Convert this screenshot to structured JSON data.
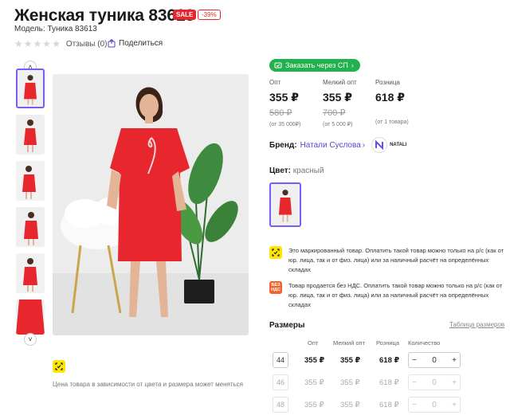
{
  "product": {
    "title": "Женская туника 83613",
    "sale_badge": "SALE",
    "discount_badge": "-39%",
    "model": "Модель: Туника 83613",
    "reviews": "Отзывы (0)",
    "share": "Поделиться",
    "rating_stars": 0
  },
  "gallery": {
    "price_note": "Цена товара в зависимости от цвета и размера может меняться"
  },
  "order_sp_button": "Заказать через СП",
  "prices": [
    {
      "head": "Опт",
      "price": "355 ₽",
      "old": "580 ₽",
      "note": "(от 35 000₽)"
    },
    {
      "head": "Мелкий опт",
      "price": "355 ₽",
      "old": "700 ₽",
      "note": "(от 5 000 ₽)"
    },
    {
      "head": "Розница",
      "price": "618 ₽",
      "old": "",
      "note": "(от 1 товара)"
    }
  ],
  "brand": {
    "label": "Бренд:",
    "name": "Натали Суслова",
    "arrow": "›",
    "logo_text": "NATALI"
  },
  "color": {
    "label": "Цвет:",
    "value": "красный"
  },
  "info": [
    {
      "text": "Это маркированный товар. Оплатить такой товар можно только на р/с (как от юр. лица, так и от физ. лица) или за наличный расчёт на определённых складах"
    },
    {
      "icon_text": "БЕЗ НДС",
      "text": "Товар продается без НДС. Оплатить такой товар можно только на р/с (как от юр. лица, так и от физ. лица) или за наличный расчёт на определённых складах"
    }
  ],
  "sizes": {
    "label": "Размеры",
    "table_link": "Таблица размеров",
    "headers": {
      "opt": "Опт",
      "small_opt": "Мелкий опт",
      "retail": "Розница",
      "qty": "Количество"
    },
    "rows": [
      {
        "size": "44",
        "opt": "355 ₽",
        "small_opt": "355 ₽",
        "retail": "618 ₽",
        "qty": "0"
      },
      {
        "size": "46",
        "opt": "355 ₽",
        "small_opt": "355 ₽",
        "retail": "618 ₽",
        "qty": "0"
      },
      {
        "size": "48",
        "opt": "355 ₽",
        "small_opt": "355 ₽",
        "retail": "618 ₽",
        "qty": "0"
      }
    ]
  },
  "colors": {
    "accent": "#7a5af8",
    "sale": "#e8262d",
    "sp_button": "#22b14c",
    "brand_link": "#5b3fd6",
    "marking": "#ffe600",
    "no_vat": "#f0652f"
  }
}
